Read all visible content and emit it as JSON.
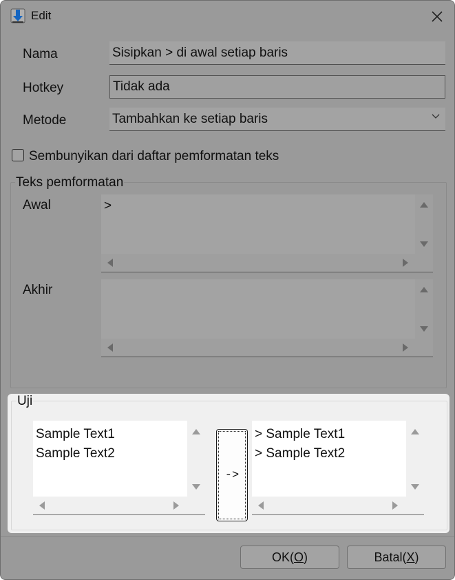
{
  "window": {
    "title": "Edit",
    "close_glyph": "✕"
  },
  "form": {
    "name_label": "Nama",
    "name_value": "Sisipkan > di awal setiap baris",
    "hotkey_label": "Hotkey",
    "hotkey_value": "Tidak ada",
    "method_label": "Metode",
    "method_value": "Tambahkan ke setiap baris",
    "hide_checkbox_label": "Sembunyikan dari daftar pemformatan teks",
    "hide_checked": false
  },
  "formatting": {
    "group_title": "Teks pemformatan",
    "start_label": "Awal",
    "start_value": ">",
    "end_label": "Akhir",
    "end_value": ""
  },
  "test": {
    "group_title": "Uji",
    "input_lines": [
      "Sample Text1",
      "Sample Text2"
    ],
    "convert_label": "->",
    "output_lines": [
      "> Sample Text1",
      "> Sample Text2"
    ]
  },
  "footer": {
    "ok_text": "OK(",
    "ok_key": "O",
    "ok_end": ")",
    "cancel_text": "Batal(",
    "cancel_key": "X",
    "cancel_end": ")"
  },
  "icons": {
    "app": "download-arrow-icon",
    "close": "close-icon",
    "dropdown": "chevron-down-icon"
  },
  "colors": {
    "accent": "#1565c0",
    "dim_overlay": "#9a9a9a",
    "test_panel": "#f0f0f0"
  }
}
